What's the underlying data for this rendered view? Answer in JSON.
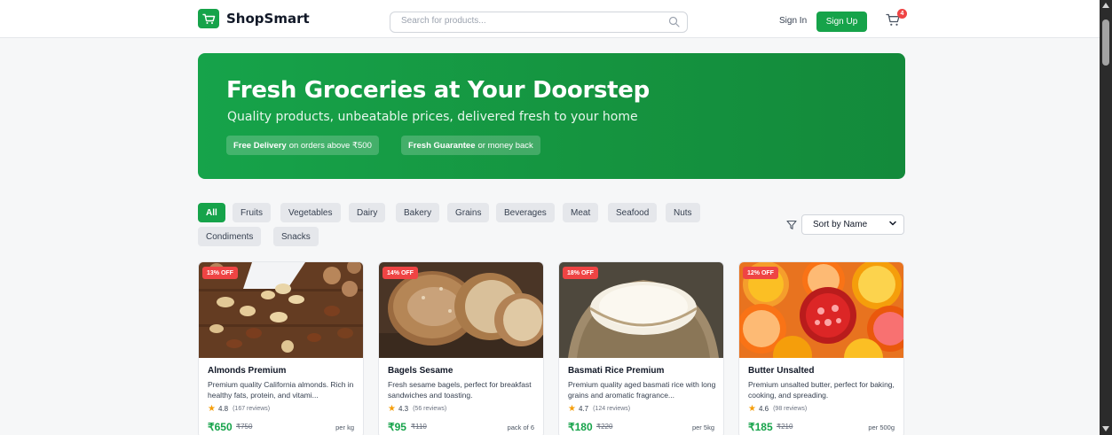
{
  "header": {
    "brand": "ShopSmart",
    "search_placeholder": "Search for products...",
    "signin_label": "Sign In",
    "signup_label": "Sign Up",
    "cart_count": "4"
  },
  "hero": {
    "title": "Fresh Groceries at Your Doorstep",
    "subtitle": "Quality products, unbeatable prices, delivered fresh to your home",
    "pill1_bold": "Free Delivery",
    "pill1_text": "on orders above ₹500",
    "pill2_bold": "Fresh Guarantee",
    "pill2_text": "or money back"
  },
  "categories": [
    "All",
    "Fruits",
    "Vegetables",
    "Dairy",
    "Bakery",
    "Grains",
    "Beverages",
    "Meat",
    "Seafood",
    "Nuts",
    "Condiments",
    "Snacks"
  ],
  "active_category": "All",
  "sort": {
    "selected": "Sort by Name"
  },
  "products": [
    {
      "badge": "13% OFF",
      "name": "Almonds Premium",
      "description": "Premium quality California almonds. Rich in healthy fats, protein, and vitami...",
      "rating": "4.8",
      "reviews": "(167 reviews)",
      "price": "₹650",
      "old_price": "₹750",
      "unit": "per kg"
    },
    {
      "badge": "14% OFF",
      "name": "Bagels Sesame",
      "description": "Fresh sesame bagels, perfect for breakfast sandwiches and toasting.",
      "rating": "4.3",
      "reviews": "(56 reviews)",
      "price": "₹95",
      "old_price": "₹110",
      "unit": "pack of 6"
    },
    {
      "badge": "18% OFF",
      "name": "Basmati Rice Premium",
      "description": "Premium quality aged basmati rice with long grains and aromatic fragrance...",
      "rating": "4.7",
      "reviews": "(124 reviews)",
      "price": "₹180",
      "old_price": "₹220",
      "unit": "per 5kg"
    },
    {
      "badge": "12% OFF",
      "name": "Butter Unsalted",
      "description": "Premium unsalted butter, perfect for baking, cooking, and spreading.",
      "rating": "4.6",
      "reviews": "(98 reviews)",
      "price": "₹185",
      "old_price": "₹210",
      "unit": "per 500g"
    }
  ],
  "colors": {
    "brand": "#16a34a",
    "badge": "#ef4444",
    "star": "#f59e0b"
  },
  "icons": {
    "logo": "cart-icon",
    "search": "search-icon",
    "cart": "cart-icon",
    "filter": "filter-icon",
    "sort": "chevron-down-icon",
    "rating": "star-icon"
  }
}
